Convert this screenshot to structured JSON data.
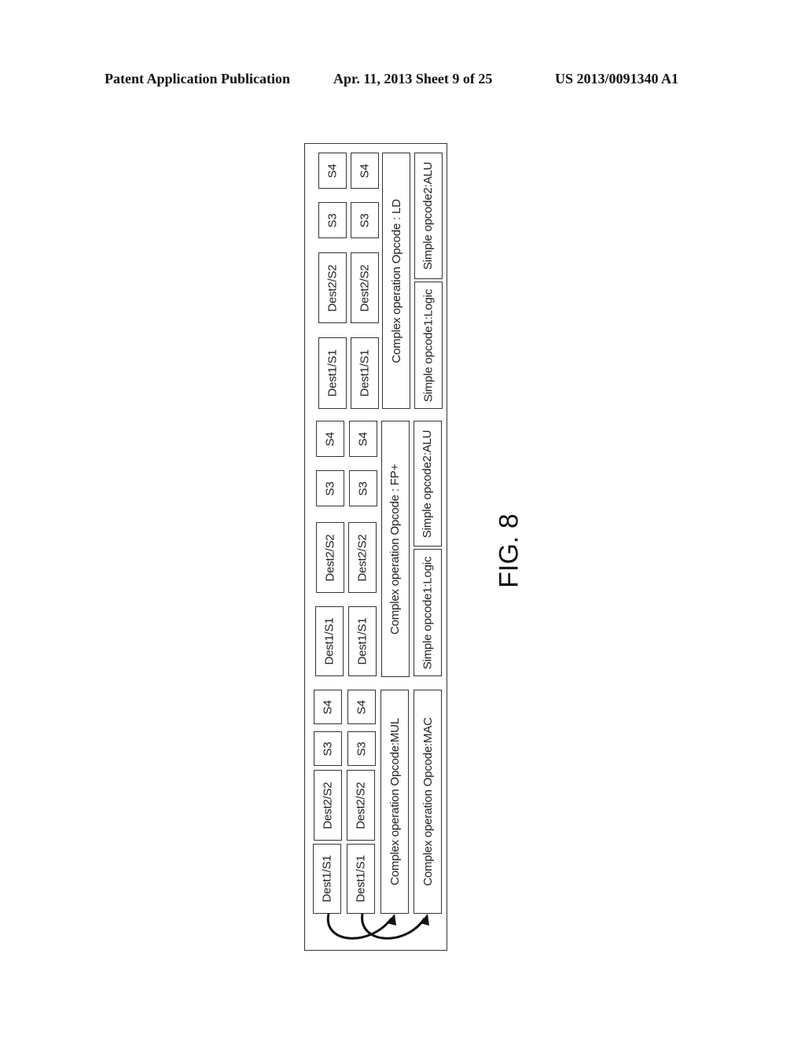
{
  "header": {
    "left": "Patent Application Publication",
    "middle": "Apr. 11, 2013  Sheet 9 of 25",
    "right": "US 2013/0091340 A1"
  },
  "figure_label": "FIG. 8",
  "groups": [
    {
      "row1": [
        "Dest1/S1",
        "Dest2/S2",
        "S3",
        "S4"
      ],
      "row2": [
        "Dest1/S1",
        "Dest2/S2",
        "S3",
        "S4"
      ],
      "complex_op": "Complex operation Opcode:MUL",
      "second_op": "Complex operation Opcode:MAC"
    },
    {
      "row1": [
        "Dest1/S1",
        "Dest2/S2",
        "S3",
        "S4"
      ],
      "row2": [
        "Dest1/S1",
        "Dest2/S2",
        "S3",
        "S4"
      ],
      "complex_op": "Complex operation Opcode : FP+",
      "simple_op1": "Simple opcode1:Logic",
      "simple_op2": "Simple opcode2:ALU"
    },
    {
      "row1": [
        "Dest1/S1",
        "Dest2/S2",
        "S3",
        "S4"
      ],
      "row2": [
        "Dest1/S1",
        "Dest2/S2",
        "S3",
        "S4"
      ],
      "complex_op": "Complex operation Opcode : LD",
      "simple_op1": "Simple opcode1:Logic",
      "simple_op2": "Simple opcode2:ALU"
    }
  ]
}
